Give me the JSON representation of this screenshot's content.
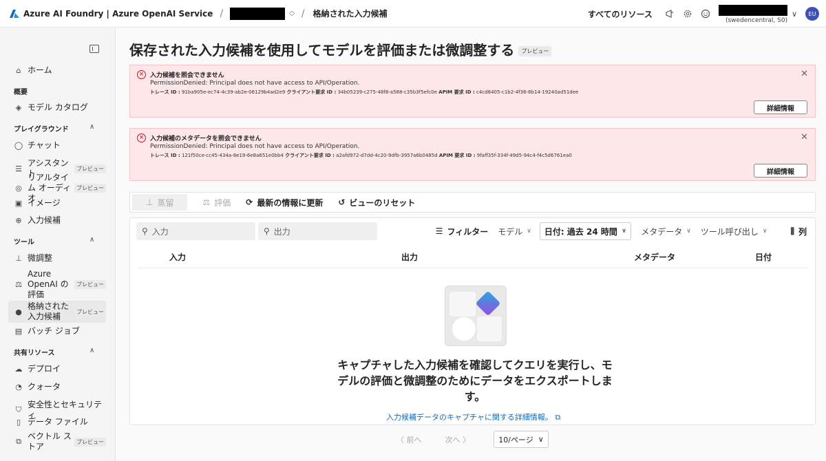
{
  "topbar": {
    "brand": "Azure AI Foundry | Azure OpenAI Service",
    "breadcrumb_current": "格納された入力候補",
    "all_resources": "すべてのリソース",
    "account_sub": "(swedencentral, S0)",
    "avatar_initials": "EU",
    "accent_color": "#3f51b5"
  },
  "sidebar": {
    "home": "ホーム",
    "section_overview": "概要",
    "model_catalog": "モデル カタログ",
    "section_playground": "プレイグラウンド",
    "chat": "チャット",
    "assistant": "アシスタント",
    "realtime_audio": "リアルタイム オーディオ",
    "image": "イメージ",
    "completions": "入力候補",
    "section_tools": "ツール",
    "finetune": "微調整",
    "azure_eval": "Azure OpenAI の評価",
    "stored_completions": "格納された入力候補",
    "batch_job": "バッチ ジョブ",
    "section_shared": "共有リソース",
    "deploy": "デプロイ",
    "quota": "クォータ",
    "safety": "安全性とセキュリティ",
    "data_files": "データ ファイル",
    "vector_store": "ベクトル ストア",
    "preview_badge": "プレビュー"
  },
  "main": {
    "title": "保存された入力候補を使用してモデルを評価または微調整する",
    "title_badge": "プレビュー"
  },
  "alerts": [
    {
      "title": "入力候補を照会できません",
      "message": "PermissionDenied: Principal does not have access to API/Operation.",
      "trace_label": "トレース ID :",
      "trace_id": "91ba905e-ec74-4c39-ab2e-06129b4ad2e9",
      "client_label": "クライアント要求 ID :",
      "client_id": "34b05239-c275-48f8-a588-c35b3f5efc0e",
      "apim_label": "APIM 要求 ID :",
      "apim_id": "c4cd8405-c1b2-4f36-8b14-19240ad51dee",
      "button": "詳細情報"
    },
    {
      "title": "入力候補のメタデータを照会できません",
      "message": "PermissionDenied: Principal does not have access to API/Operation.",
      "trace_label": "トレース ID :",
      "trace_id": "121f50ce-cc45-434a-8e19-6e8a651e0bb4",
      "client_label": "クライアント要求 ID :",
      "client_id": "a2afd972-d7dd-4c20-9dfb-3957a6b0485d",
      "apim_label": "APIM 要求 ID :",
      "apim_id": "9faff35f-334f-49d5-94c4-f4c5d6761ea0",
      "button": "詳細情報"
    }
  ],
  "toolbar": {
    "distill": "蒸留",
    "evaluate": "評価",
    "refresh": "最新の情報に更新",
    "reset_view": "ビューのリセット"
  },
  "filters": {
    "input_placeholder": "入力",
    "output_placeholder": "出力",
    "filter": "フィルター",
    "model": "モデル",
    "date": "日付: 過去 24 時間",
    "metadata": "メタデータ",
    "tool_calls": "ツール呼び出し",
    "columns": "列"
  },
  "table": {
    "headers": [
      "入力",
      "出力",
      "メタデータ",
      "日付"
    ]
  },
  "empty_state": {
    "message": "キャプチャした入力候補を確認してクエリを実行し、モデルの評価と微調整のためにデータをエクスポートします。",
    "link": "入力候補データのキャプチャに関する詳細情報。"
  },
  "pager": {
    "prev": "前へ",
    "next": "次へ",
    "page_size": "10/ページ"
  }
}
